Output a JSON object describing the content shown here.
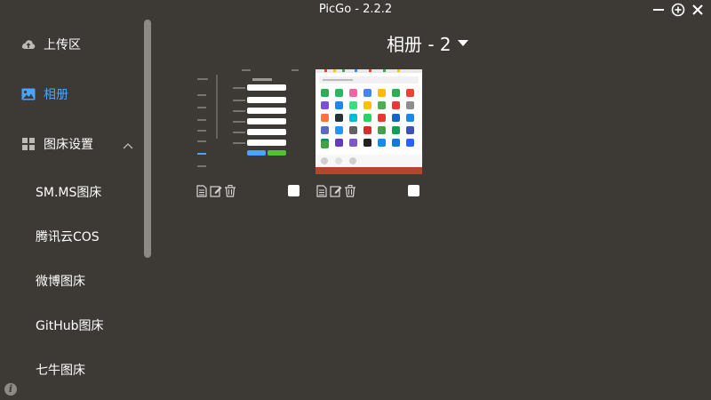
{
  "app": {
    "title": "PicGo - 2.2.2"
  },
  "sidebar": {
    "items": [
      {
        "label": "上传区",
        "icon": "cloud-upload-icon",
        "active": false
      },
      {
        "label": "相册",
        "icon": "image-icon",
        "active": true
      },
      {
        "label": "图床设置",
        "icon": "grid-icon",
        "expanded": true
      }
    ],
    "sub_items": [
      {
        "label": "SM.MS图床"
      },
      {
        "label": "腾讯云COS"
      },
      {
        "label": "微博图床"
      },
      {
        "label": "GitHub图床"
      },
      {
        "label": "七牛图床"
      }
    ]
  },
  "gallery": {
    "title": "相册 - 2",
    "dropdown_icon": "caret-down-icon",
    "images": [
      {
        "id": "screenshot-form",
        "checked": false
      },
      {
        "id": "screenshot-icon-grid",
        "checked": false
      }
    ]
  },
  "colors": {
    "background": "#3d3a36",
    "active": "#4aa3ff",
    "text": "#ffffff",
    "muted": "#8d8a86"
  }
}
